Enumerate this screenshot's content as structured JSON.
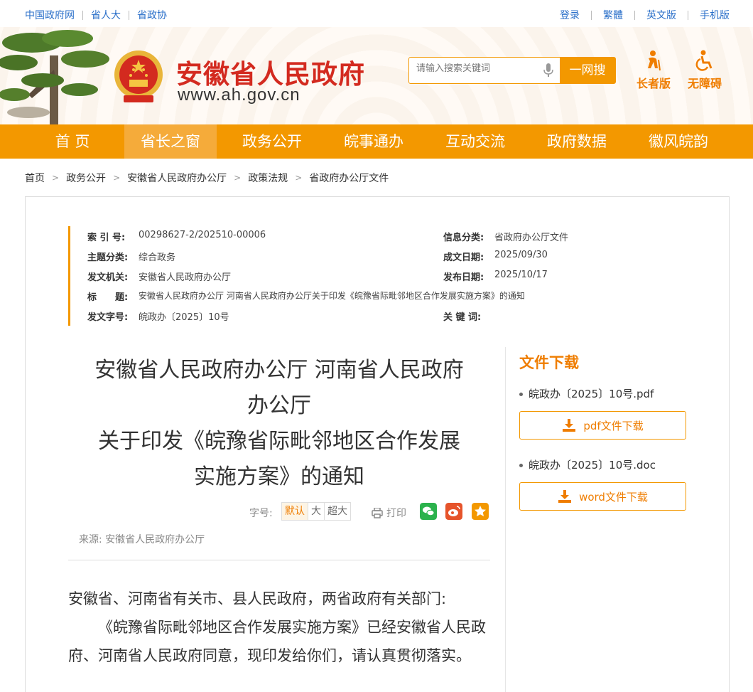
{
  "topbar": {
    "left_links": [
      "中国政府网",
      "省人大",
      "省政协"
    ],
    "right_links": [
      "登录",
      "繁體",
      "英文版",
      "手机版"
    ]
  },
  "header": {
    "site_title": "安徽省人民政府",
    "site_url": "www.ah.gov.cn",
    "search_placeholder": "请输入搜索关键词",
    "search_button": "一网搜",
    "elder_label": "长者版",
    "barrier_free_label": "无障碍"
  },
  "nav": {
    "items": [
      "首 页",
      "省长之窗",
      "政务公开",
      "皖事通办",
      "互动交流",
      "政府数据",
      "徽风皖韵"
    ],
    "active_index": 1
  },
  "breadcrumb": [
    "首页",
    "政务公开",
    "安徽省人民政府办公厅",
    "政策法规",
    "省政府办公厅文件"
  ],
  "meta": {
    "index_no_label": "索 引 号:",
    "index_no": "00298627-2/202510-00006",
    "info_category_label": "信息分类:",
    "info_category": "省政府办公厅文件",
    "subject_label": "主题分类:",
    "subject": "综合政务",
    "created_label": "成文日期:",
    "created": "2025/09/30",
    "issuer_label": "发文机关:",
    "issuer": "安徽省人民政府办公厅",
    "published_label": "发布日期:",
    "published": "2025/10/17",
    "doc_title_label": "标　　题:",
    "doc_title": "安徽省人民政府办公厅 河南省人民政府办公厅关于印发《皖豫省际毗邻地区合作发展实施方案》的通知",
    "doc_no_label": "发文字号:",
    "doc_no": "皖政办〔2025〕10号",
    "keywords_label": "关 键 词:",
    "keywords": ""
  },
  "article": {
    "title_lines": [
      "安徽省人民政府办公厅 河南省人民政府",
      "办公厅",
      "关于印发《皖豫省际毗邻地区合作发展",
      "实施方案》的通知"
    ],
    "font_size_label": "字号:",
    "font_sizes": [
      "默认",
      "大",
      "超大"
    ],
    "print_label": "打印",
    "source": "来源:  安徽省人民政府办公厅",
    "salutation": "安徽省、河南省有关市、县人民政府，两省政府有关部门:",
    "paragraph1": "《皖豫省际毗邻地区合作发展实施方案》已经安徽省人民政府、河南省人民政府同意，现印发给你们，请认真贯彻落实。"
  },
  "downloads": {
    "title": "文件下载",
    "files": [
      {
        "name": "皖政办〔2025〕10号.pdf",
        "button": "pdf文件下载"
      },
      {
        "name": "皖政办〔2025〕10号.doc",
        "button": "word文件下载"
      }
    ]
  },
  "colors": {
    "accent": "#f39800",
    "title_red": "#d32a1f",
    "link_blue": "#2a6fc9"
  }
}
